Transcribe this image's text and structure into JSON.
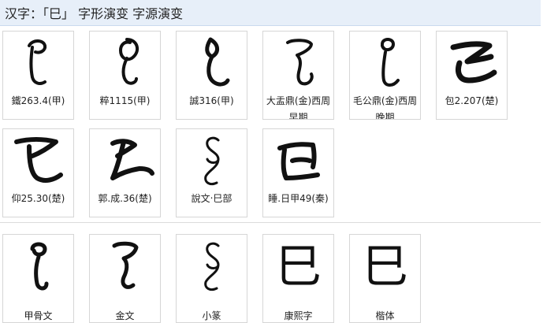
{
  "title": "汉字：「巳」 字形演变 字源演变",
  "evolution": [
    {
      "caption": "鐵263.4(甲)",
      "glyph": "oracle-bone-si-icon"
    },
    {
      "caption": "粹1115(甲)",
      "glyph": "oracle-bone-si-icon"
    },
    {
      "caption": "誠316(甲)",
      "glyph": "oracle-bone-si-icon"
    },
    {
      "caption": "大盂鼎(金)西周早期",
      "glyph": "bronze-si-icon"
    },
    {
      "caption": "毛公鼎(金)西周晚期",
      "glyph": "bronze-si-icon"
    },
    {
      "caption": "包2.207(楚)",
      "glyph": "chu-slip-si-icon"
    },
    {
      "caption": "仰25.30(楚)",
      "glyph": "chu-slip-si-icon"
    },
    {
      "caption": "郭.成.36(楚)",
      "glyph": "chu-slip-si-icon"
    },
    {
      "caption": "說文‧巳部",
      "glyph": "small-seal-si-icon"
    },
    {
      "caption": "睡.日甲49(秦)",
      "glyph": "qin-slip-si-icon"
    }
  ],
  "scripts": [
    {
      "caption": "甲骨文",
      "glyph": "oracle-bone-si-icon"
    },
    {
      "caption": "金文",
      "glyph": "bronze-si-icon"
    },
    {
      "caption": "小篆",
      "glyph": "small-seal-si-icon"
    },
    {
      "caption": "康熙字",
      "glyph": "kangxi-si-icon",
      "char": "巳"
    },
    {
      "caption": "楷体",
      "glyph": "regular-script-si-icon",
      "char": "巳"
    }
  ]
}
